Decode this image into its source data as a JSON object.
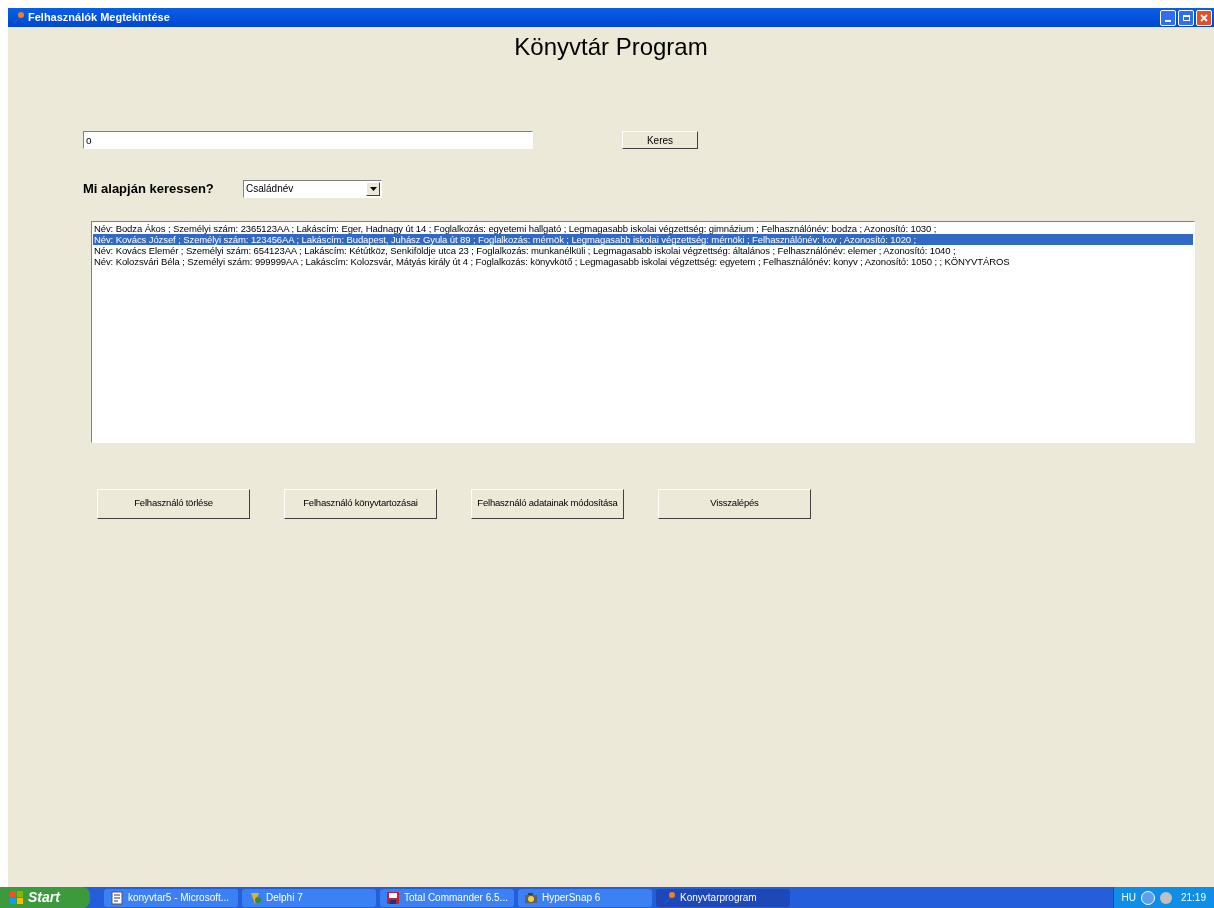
{
  "window": {
    "title": "Felhasználók Megtekintése"
  },
  "heading": "Könyvtár Program",
  "search": {
    "value": "o",
    "button": "Keres"
  },
  "criterion": {
    "label": "Mi alapján keressen?",
    "value": "Családnév"
  },
  "results": [
    {
      "text": "Név: Bodza Ákos ; Személyi szám: 2365123AA ; Lakáscím: Eger, Hadnagy út 14 ; Foglalkozás: egyetemi hallgató ; Legmagasabb iskolai végzettség: gimnázium ; Felhasználónév: bodza ; Azonosító: 1030 ;",
      "selected": false
    },
    {
      "text": "Név: Kovács József ; Személyi szám: 123456AA ; Lakáscím: Budapest, Juhász Gyula út 89 ; Foglalkozás: mérnök ; Legmagasabb iskolai végzettség: mérnöki ; Felhasználónév: kov ; Azonosító: 1020 ;",
      "selected": true
    },
    {
      "text": "Név: Kovács Elemér ; Személyi szám: 654123AA ; Lakáscím: Kétútköz, Senkiföldje utca 23 ; Foglalkozás: munkanélküli ; Legmagasabb iskolai végzettség: általános ; Felhasználónév: elemer ; Azonosító: 1040 ;",
      "selected": false
    },
    {
      "text": "Név: Kolozsvári Béla ; Személyi szám: 999999AA ; Lakáscím: Kolozsvár, Mátyás király út 4 ; Foglalkozás: könyvkötő ; Legmagasabb iskolai végzettség: egyetem ; Felhasználónév: konyv ; Azonosító: 1050 ;  ; KÖNYVTÁROS",
      "selected": false
    }
  ],
  "buttons": [
    "Felhasználó törlése",
    "Felhasználó könyvtartozásai",
    "Felhasználó adatainak módosítása",
    "Visszalépés"
  ],
  "taskbar": {
    "start": "Start",
    "items": [
      {
        "label": "konyvtar5 - Microsoft...",
        "kind": "document",
        "active": false
      },
      {
        "label": "Delphi 7",
        "kind": "delphi",
        "active": false
      },
      {
        "label": "Total Commander 6.5...",
        "kind": "disk",
        "active": false
      },
      {
        "label": "HyperSnap 6",
        "kind": "camera",
        "active": false
      },
      {
        "label": "Konyvtarprogram",
        "kind": "torch",
        "active": true
      }
    ],
    "language": "HU",
    "clock": "21:19"
  }
}
